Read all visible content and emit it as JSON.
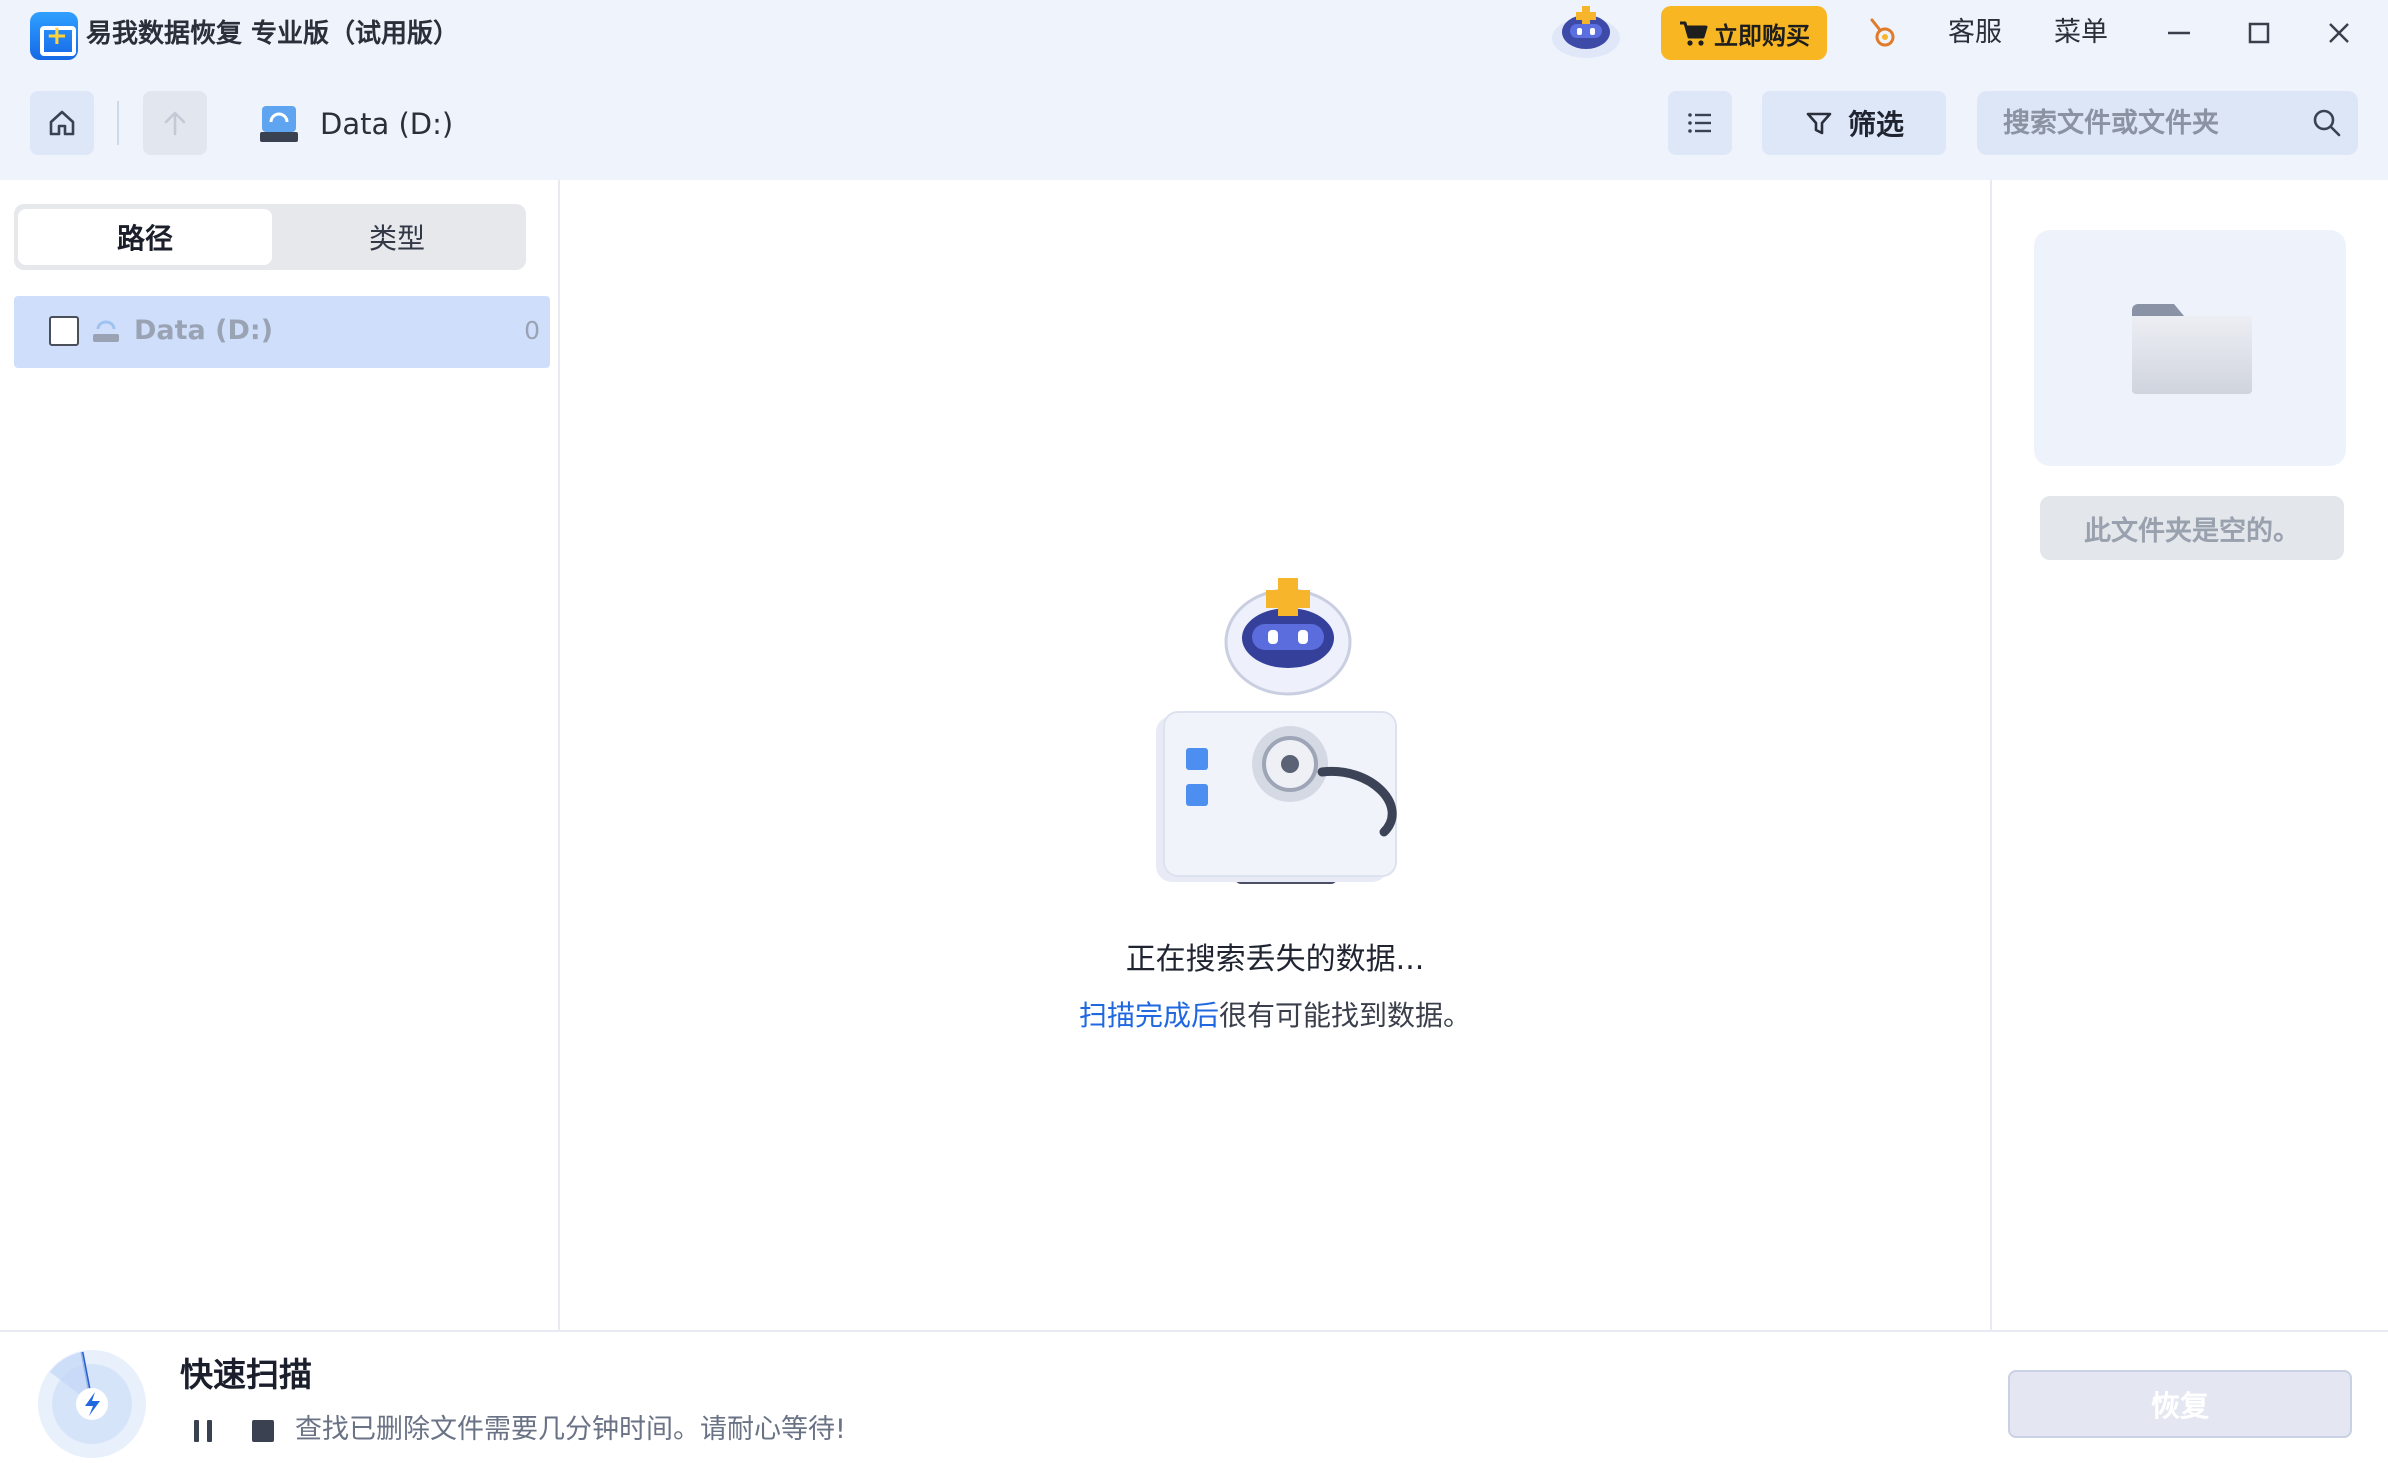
{
  "window": {
    "title": "易我数据恢复 专业版（试用版）",
    "buy_label": "立即购买",
    "support_label": "客服",
    "menu_label": "菜单"
  },
  "toolbar": {
    "location_label": "Data (D:)",
    "filter_label": "筛选",
    "search_placeholder": "搜索文件或文件夹"
  },
  "sidebar": {
    "tabs": [
      {
        "label": "路径",
        "active": true
      },
      {
        "label": "类型",
        "active": false
      }
    ],
    "tree": [
      {
        "label": "Data (D:)",
        "count": "0",
        "checked": false
      }
    ]
  },
  "main": {
    "status_title": "正在搜索丢失的数据...",
    "status_link": "扫描完成后",
    "status_rest": "很有可能找到数据。"
  },
  "preview": {
    "empty_message": "此文件夹是空的。"
  },
  "scan": {
    "title": "快速扫描",
    "hint": "查找已删除文件需要几分钟时间。请耐心等待!",
    "recover_label": "恢复"
  },
  "colors": {
    "header_bg": "#eef3fc",
    "accent_blue": "#1f68e0",
    "buy_orange": "#f8b623",
    "selected_row": "#cfdffb"
  },
  "icons": [
    "app-logo-icon",
    "mascot-icon",
    "cart-icon",
    "gift-icon",
    "minimize-icon",
    "maximize-icon",
    "close-icon",
    "home-icon",
    "up-arrow-icon",
    "drive-icon",
    "list-view-icon",
    "filter-icon",
    "search-icon",
    "folder-icon",
    "scan-progress-icon",
    "pause-icon",
    "stop-icon"
  ]
}
